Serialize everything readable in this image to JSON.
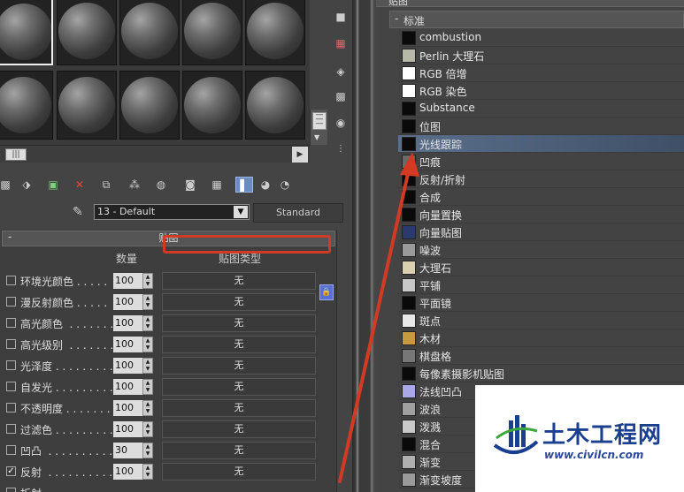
{
  "slots": {
    "count": 10,
    "selected_index": 0
  },
  "toolbar": {
    "tools": [
      "get-material-icon",
      "put-to-scene-icon",
      "assign-material-icon",
      "reset-icon",
      "make-copy-icon",
      "make-unique-icon",
      "put-to-library-icon",
      "material-id-icon",
      "show-map-icon",
      "show-end-result-icon",
      "go-to-parent-icon",
      "go-forward-icon"
    ],
    "active_tool": "show-end-result-icon"
  },
  "material": {
    "name": "13 - Default",
    "type_button": "Standard"
  },
  "maps_panel": {
    "collapse": "-",
    "title": "贴图",
    "col_amount": "数量",
    "col_map_type": "贴图类型",
    "rows": [
      {
        "label": "环境光颜色 . . . . .",
        "checked": false,
        "checkmark": "",
        "amount": "100",
        "map": "无"
      },
      {
        "label": "漫反射颜色 . . . . .",
        "checked": false,
        "checkmark": "",
        "amount": "100",
        "map": "无"
      },
      {
        "label": "高光颜色  . . . . . . .",
        "checked": false,
        "checkmark": "",
        "amount": "100",
        "map": "无"
      },
      {
        "label": "高光级别  . . . . . . .",
        "checked": false,
        "checkmark": "",
        "amount": "100",
        "map": "无"
      },
      {
        "label": "光泽度 . . . . . . . . .",
        "checked": false,
        "checkmark": "",
        "amount": "100",
        "map": "无"
      },
      {
        "label": "自发光 . . . . . . . . .",
        "checked": false,
        "checkmark": "",
        "amount": "100",
        "map": "无"
      },
      {
        "label": "不透明度 . . . . . . .",
        "checked": false,
        "checkmark": "",
        "amount": "100",
        "map": "无"
      },
      {
        "label": "过滤色 . . . . . . . . .",
        "checked": false,
        "checkmark": "",
        "amount": "100",
        "map": "无"
      },
      {
        "label": "凹凸  . . . . . . . . . . .",
        "checked": false,
        "checkmark": "",
        "amount": "30",
        "map": "无"
      },
      {
        "label": "反射  . . . . . . . . . . .",
        "checked": true,
        "checkmark": "✓",
        "amount": "100",
        "map": "无"
      },
      {
        "label": "折射",
        "checked": false,
        "checkmark": "",
        "amount": "",
        "map": ""
      }
    ],
    "highlighted_row_index": 9
  },
  "map_browser": {
    "top_label": "贴图",
    "group_collapse": "-",
    "group_label": "标准",
    "items": [
      {
        "label": "combustion",
        "swatch": "#0a0a0a"
      },
      {
        "label": "Perlin 大理石",
        "swatch": "#b8b8a8"
      },
      {
        "label": "RGB 倍增",
        "swatch": "#ffffff"
      },
      {
        "label": "RGB 染色",
        "swatch": "#ffffff"
      },
      {
        "label": "Substance",
        "swatch": "#0a0a0a"
      },
      {
        "label": "位图",
        "swatch": "#0a0a0a"
      },
      {
        "label": "光线跟踪",
        "swatch": "#0a0a0a"
      },
      {
        "label": "凹痕",
        "swatch": "#6a6a6a"
      },
      {
        "label": "反射/折射",
        "swatch": "#0a0a0a"
      },
      {
        "label": "合成",
        "swatch": "#0a0a0a"
      },
      {
        "label": "向量置换",
        "swatch": "#0a0a0a"
      },
      {
        "label": "向量贴图",
        "swatch": "#2a3a6a"
      },
      {
        "label": "噪波",
        "swatch": "#9a9a9a"
      },
      {
        "label": "大理石",
        "swatch": "#d8d0b0"
      },
      {
        "label": "平铺",
        "swatch": "#c8c8c8"
      },
      {
        "label": "平面镜",
        "swatch": "#0a0a0a"
      },
      {
        "label": "斑点",
        "swatch": "#e8e8e8"
      },
      {
        "label": "木材",
        "swatch": "#c89a40"
      },
      {
        "label": "棋盘格",
        "swatch": "#777777"
      },
      {
        "label": "每像素摄影机贴图",
        "swatch": "#0a0a0a"
      },
      {
        "label": "法线凹凸",
        "swatch": "#a8a8e8"
      },
      {
        "label": "波浪",
        "swatch": "#a0a0a0"
      },
      {
        "label": "泼溅",
        "swatch": "#c8c8c8"
      },
      {
        "label": "混合",
        "swatch": "#0a0a0a"
      },
      {
        "label": "渐变",
        "swatch": "#b0b0b0"
      },
      {
        "label": "渐变坡度",
        "swatch": "#9a9a9a"
      }
    ],
    "highlighted_index": 6
  },
  "watermark": {
    "title": "土木工程网",
    "url": "www.civilcn.com"
  },
  "colors": {
    "highlight_box": "#d23a24",
    "arrow": "#d23a24",
    "watermark_blue": "#1a3f8f",
    "watermark_green": "#3aa83a"
  }
}
